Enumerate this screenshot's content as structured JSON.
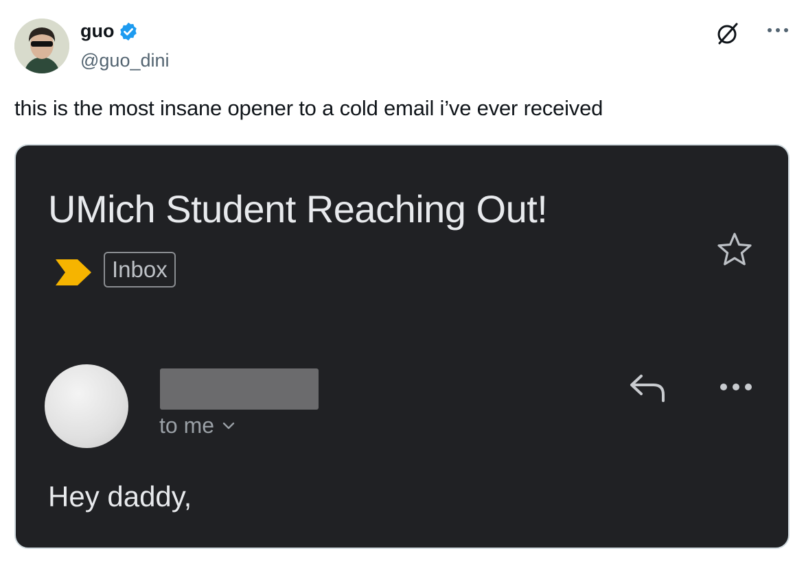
{
  "tweet": {
    "author_name": "guo",
    "author_handle": "@guo_dini",
    "text": "this is the most insane opener to a cold email i’ve ever received"
  },
  "email": {
    "subject": "UMich Student Reaching Out!",
    "label": "Inbox",
    "recipient": "to me",
    "greeting": "Hey daddy,"
  },
  "icons": {
    "verified": "verified-badge-icon",
    "grok": "grok-icon",
    "more": "more-horizontal-icon",
    "importance": "importance-marker-icon",
    "star": "star-icon",
    "reply": "reply-icon"
  },
  "colors": {
    "verified_blue": "#1d9bf0",
    "importance_yellow": "#f6b400",
    "email_bg": "#202124"
  }
}
